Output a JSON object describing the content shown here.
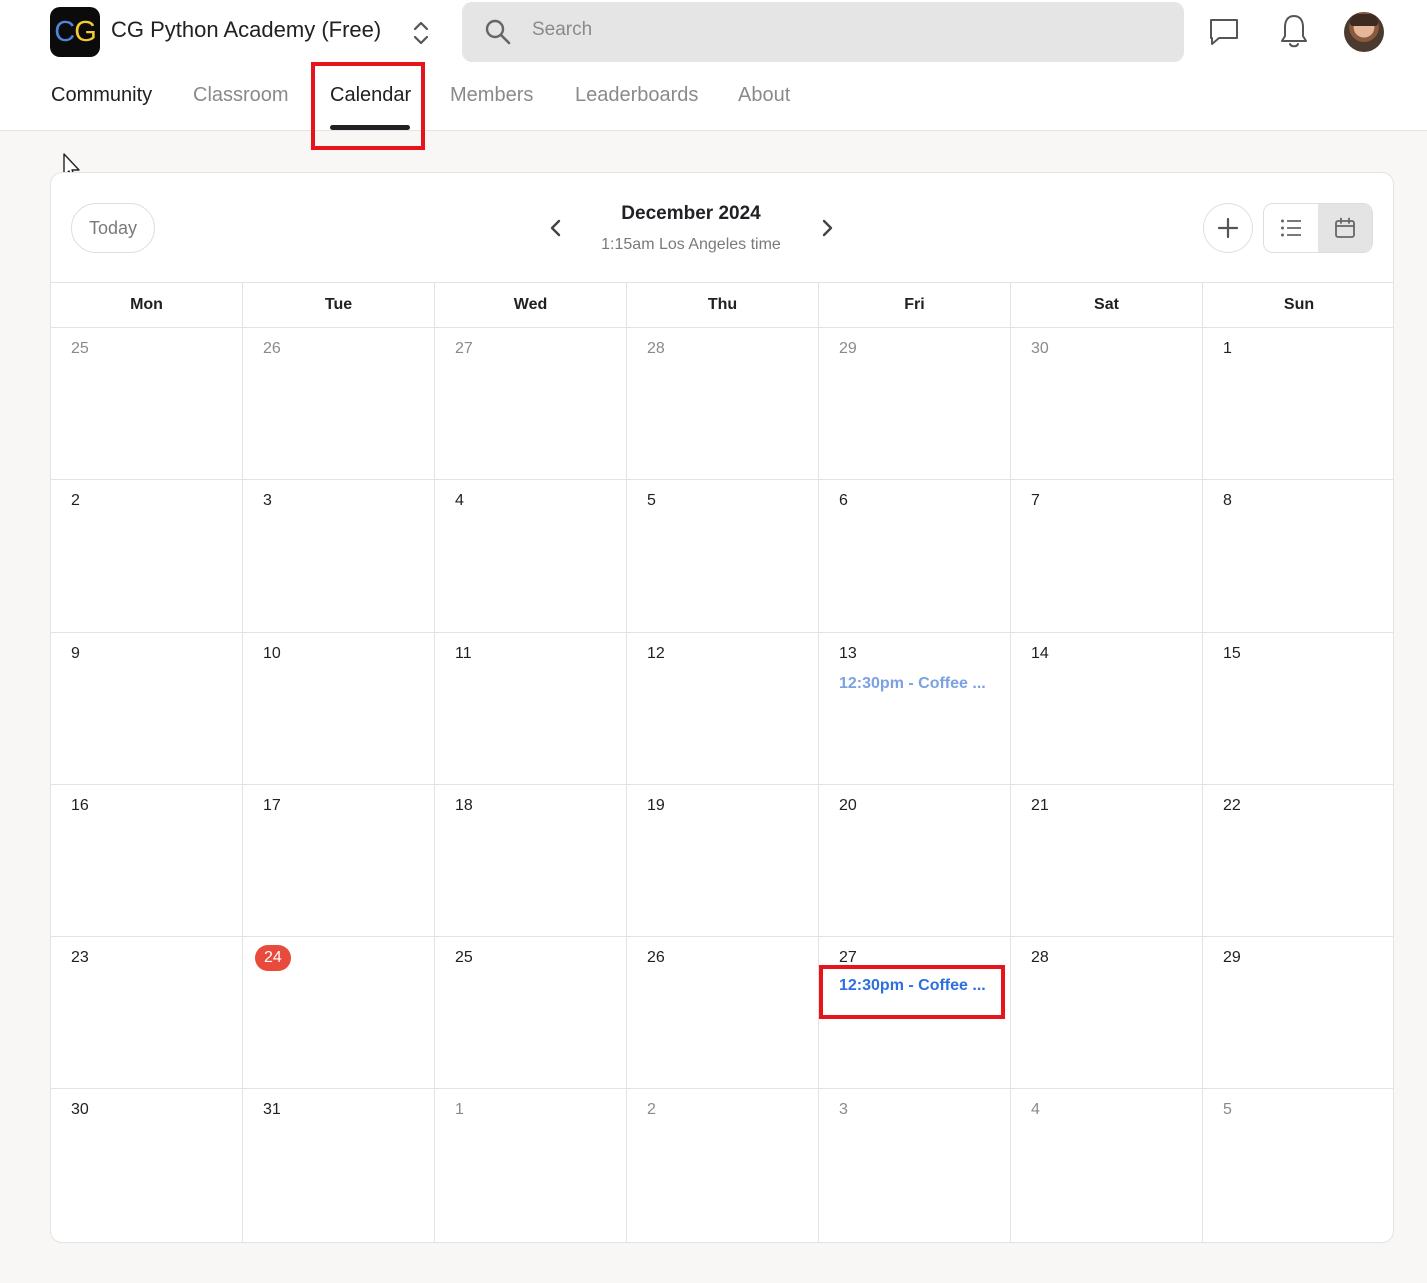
{
  "header": {
    "logo_c": "C",
    "logo_g": "G",
    "title": "CG Python Academy (Free)",
    "search_placeholder": "Search"
  },
  "nav": {
    "tabs": [
      "Community",
      "Classroom",
      "Calendar",
      "Members",
      "Leaderboards",
      "About"
    ],
    "active": "Calendar"
  },
  "calendar": {
    "today_label": "Today",
    "month": "December 2024",
    "timezone_text": "1:15am Los Angeles time",
    "weekdays": [
      "Mon",
      "Tue",
      "Wed",
      "Thu",
      "Fri",
      "Sat",
      "Sun"
    ],
    "weeks": [
      [
        "25",
        "26",
        "27",
        "28",
        "29",
        "30",
        "1"
      ],
      [
        "2",
        "3",
        "4",
        "5",
        "6",
        "7",
        "8"
      ],
      [
        "9",
        "10",
        "11",
        "12",
        "13",
        "14",
        "15"
      ],
      [
        "16",
        "17",
        "18",
        "19",
        "20",
        "21",
        "22"
      ],
      [
        "23",
        "24",
        "25",
        "26",
        "27",
        "28",
        "29"
      ],
      [
        "30",
        "31",
        "1",
        "2",
        "3",
        "4",
        "5"
      ]
    ],
    "today_day": "24",
    "events": {
      "dec13": "12:30pm - Coffee ...",
      "dec27": "12:30pm - Coffee ..."
    }
  },
  "colors": {
    "accent_today": "#e84a3b",
    "event_blue": "#2d6fe0",
    "event_light_blue": "#7ba1e3",
    "highlight_red": "#e8141b"
  }
}
